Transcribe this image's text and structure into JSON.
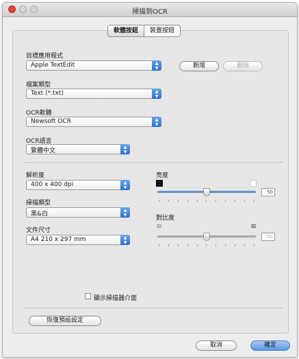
{
  "window": {
    "title": "掃描到OCR"
  },
  "tabs": [
    {
      "label": "軟體按鈕",
      "active": true
    },
    {
      "label": "裝置按鈕",
      "active": false
    }
  ],
  "target_app": {
    "label": "目標應用程式",
    "value": "Apple TextEdit",
    "add_label": "新增",
    "delete_label": "刪除"
  },
  "file_type": {
    "label": "檔案類型",
    "value": "Text (*.txt)"
  },
  "ocr_software": {
    "label": "OCR軟體",
    "value": "Newsoft OCR"
  },
  "ocr_language": {
    "label": "OCR語言",
    "value": "繁體中文"
  },
  "resolution": {
    "label": "解析度",
    "value": "400 x 400 dpi"
  },
  "scan_type": {
    "label": "掃描類型",
    "value": "黑&白"
  },
  "document_size": {
    "label": "文件尺寸",
    "value": "A4 210 x 297 mm"
  },
  "brightness": {
    "label": "亮度",
    "value": "50",
    "level": 0.5
  },
  "contrast": {
    "label": "對比度",
    "value": "50",
    "level": 0.5,
    "enabled": false
  },
  "show_scanner_interface": {
    "label": "顯示掃描器介面",
    "checked": false
  },
  "restore_defaults_label": "恢復預設設定",
  "cancel_label": "取消",
  "ok_label": "確定",
  "colors": {
    "accent": "#3a7fd9",
    "close": "#e0443a"
  }
}
